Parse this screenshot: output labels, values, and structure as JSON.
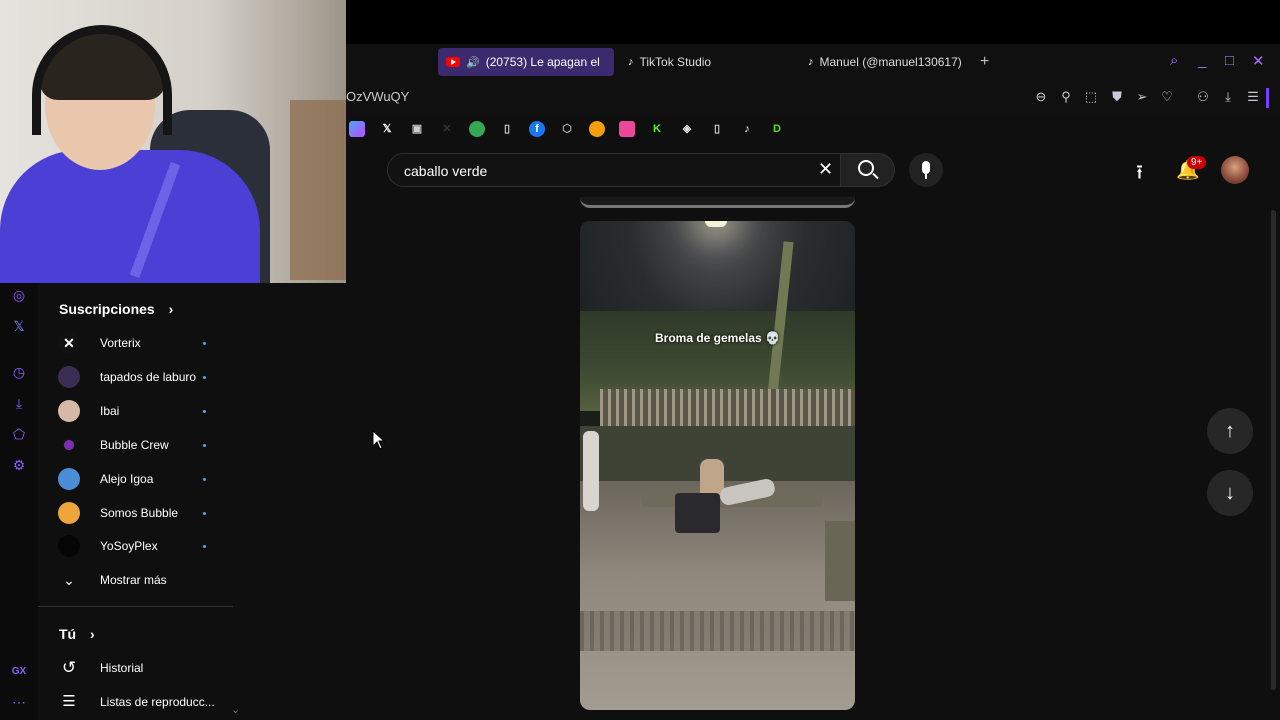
{
  "tabs": [
    {
      "label": "(20753) Le apagan el",
      "icon": "youtube-icon",
      "active": true
    },
    {
      "label": "TikTok Studio",
      "icon": "tiktok-icon"
    },
    {
      "label": "Manuel (@manuel130617)",
      "icon": "tiktok-icon"
    }
  ],
  "address_bar": {
    "url": "OzVWuQY"
  },
  "search": {
    "query": "caballo verde"
  },
  "header": {
    "notification_count": "9+"
  },
  "guide": {
    "subscriptions_heading": "Suscripciones",
    "subscriptions": [
      {
        "label": "Vorterix",
        "color": "#111111"
      },
      {
        "label": "tapados de laburo",
        "color": "#3a2e55"
      },
      {
        "label": "Ibai",
        "color": "#d7b7a6"
      },
      {
        "label": "Bubble Crew",
        "color": "#7a2fb0"
      },
      {
        "label": "Alejo Igoa",
        "color": "#4a8ed8"
      },
      {
        "label": "Somos Bubble",
        "color": "#f0a53a"
      },
      {
        "label": "YoSoyPlex",
        "color": "#050505"
      }
    ],
    "show_more": "Mostrar más",
    "you_heading": "Tú",
    "history": "Historial",
    "playlists": "Listas de reproducc..."
  },
  "video": {
    "caption": "Broma de gemelas"
  },
  "colors": {
    "accent": "#8c5cff",
    "active_tab": "#3b2a6e",
    "background": "#0f0f0f"
  }
}
